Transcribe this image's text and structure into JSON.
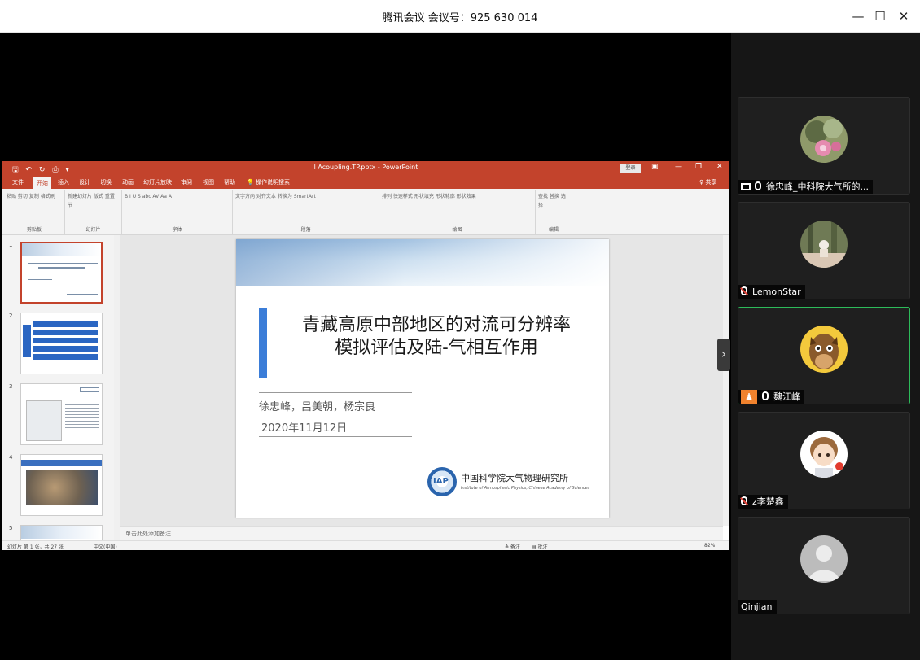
{
  "window": {
    "title": "腾讯会议 会议号：925 630 014",
    "minimize_glyph": "—",
    "maximize_glyph": "☐",
    "close_glyph": "✕"
  },
  "powerpoint": {
    "title": "l Acoupling.TP.pptx  -  PowerPoint",
    "quick_access": "🖫 ↶ ↻ ⎙ ▾",
    "login_label": "登录",
    "control_glyphs": [
      "▣",
      "—",
      "❐",
      "✕"
    ],
    "tabs": [
      "文件",
      "开始",
      "插入",
      "设计",
      "切换",
      "动画",
      "幻灯片放映",
      "审阅",
      "视图",
      "帮助",
      "💡 操作说明搜索"
    ],
    "active_tab": "开始",
    "share_label": "♀ 共享",
    "ribbon_groups": [
      {
        "label": "剪贴板",
        "items": "粘贴 剪切 复制 格式刷"
      },
      {
        "label": "幻灯片",
        "items": "新建幻灯片 版式 重置 节"
      },
      {
        "label": "字体",
        "items": "B I U S abc AV Aa A"
      },
      {
        "label": "段落",
        "items": "文字方向 对齐文本 转换为 SmartArt"
      },
      {
        "label": "绘图",
        "items": "排列 快速样式 形状填充 形状轮廓 形状效果"
      },
      {
        "label": "编辑",
        "items": "查找 替换 选择"
      }
    ],
    "thumbnail_numbers": [
      "1",
      "2",
      "3",
      "4",
      "5"
    ],
    "slide": {
      "title_line1": "青藏高原中部地区的对流可分辨率",
      "title_line2": "模拟评估及陆-气相互作用",
      "authors": "徐忠峰，吕美朝，杨宗良",
      "date": "2020年11月12日",
      "logo_text": "IAP",
      "institute_cn": "中国科学院大气物理研究所",
      "institute_en": "Institute of Atmospheric Physics, Chinese Academy of Sciences"
    },
    "notes_placeholder": "单击此处添加备注",
    "status": {
      "slide_count": "幻灯片 第 1 张，共 27 张",
      "language": "中文(中国)",
      "notes_btn": "≜ 备注",
      "comments_btn": "▤ 批注",
      "zoom": "82%"
    }
  },
  "participants": [
    {
      "name": "徐忠峰_中科院大气所的...",
      "mic_muted": false,
      "sharing": true
    },
    {
      "name": "LemonStar",
      "mic_muted": true
    },
    {
      "name": "魏江峰",
      "mic_muted": false,
      "active_speaker": true
    },
    {
      "name": "z李楚鑫",
      "mic_muted": true
    },
    {
      "name": "Qinjian",
      "mic_muted": null
    }
  ],
  "colors": {
    "ppt_accent": "#c3432c",
    "active_border": "#2dbb5a",
    "slide_accent": "#3b7dd8"
  },
  "icons": {
    "panel_toggle": "›"
  }
}
